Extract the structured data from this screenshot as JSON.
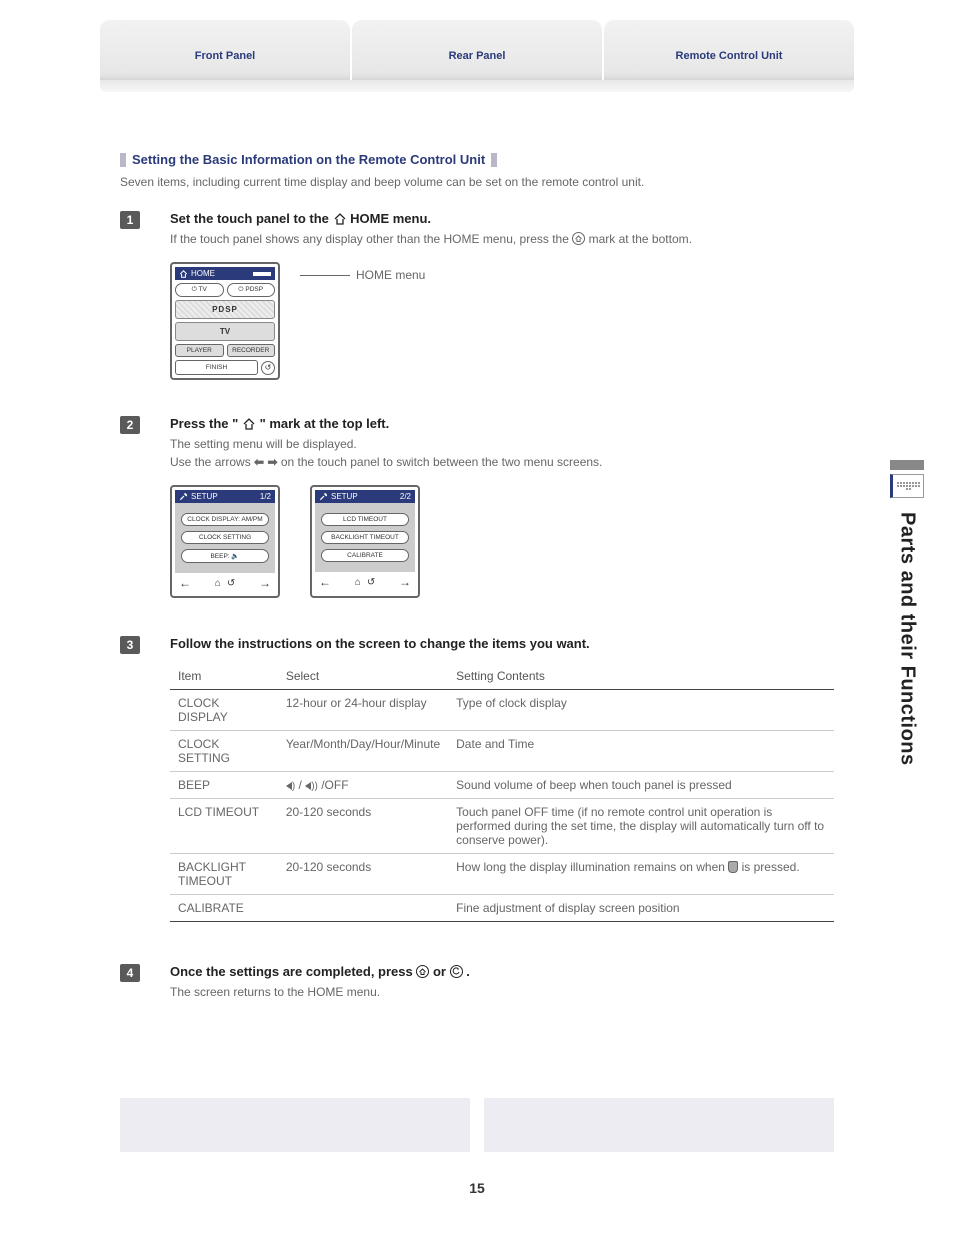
{
  "tabs": {
    "front": "Front Panel",
    "rear": "Rear Panel",
    "remote": "Remote Control Unit"
  },
  "section": {
    "title": "Setting the Basic Information on the Remote Control Unit",
    "intro": "Seven items, including current time display and beep volume can be set on the remote control unit."
  },
  "steps": {
    "s1": {
      "num": "1",
      "title_a": "Set the touch panel to the ",
      "title_b": " HOME menu.",
      "text_a": "If the touch panel shows any display other than the HOME menu, press the ",
      "text_b": " mark at the bottom.",
      "leader": "HOME menu"
    },
    "s2": {
      "num": "2",
      "title_a": "Press the \"",
      "title_b": "\" mark at the top left.",
      "text1": "The setting menu will be displayed.",
      "text2_a": "Use the arrows ",
      "text2_b": " on the touch panel to switch between the two menu screens."
    },
    "s3": {
      "num": "3",
      "title": "Follow the instructions on the screen to change the items you want."
    },
    "s4": {
      "num": "4",
      "title_a": "Once the settings are completed, press ",
      "title_b": " or ",
      "title_c": ".",
      "text": "The screen returns to the HOME menu."
    }
  },
  "home_screen": {
    "header": "HOME",
    "btn_tv_power": "⏻ TV",
    "btn_pdsp_power": "⏻ PDSP",
    "wide": "PDSP",
    "tv": "TV",
    "player": "PLAYER",
    "recorder": "RECORDER",
    "finish": "FINISH"
  },
  "setup_screens": {
    "s1": {
      "title": "SETUP",
      "page": "1/2",
      "items": [
        "CLOCK DISPLAY: AM/PM",
        "CLOCK SETTING",
        "BEEP: 🔈"
      ]
    },
    "s2": {
      "title": "SETUP",
      "page": "2/2",
      "items": [
        "LCD TIMEOUT",
        "BACKLIGHT TIMEOUT",
        "CALIBRATE"
      ]
    }
  },
  "table": {
    "headers": {
      "item": "Item",
      "select": "Select",
      "contents": "Setting Contents"
    },
    "rows": [
      {
        "item": "CLOCK DISPLAY",
        "select": "12-hour or 24-hour display",
        "contents": "Type of clock display"
      },
      {
        "item": "CLOCK SETTING",
        "select": "Year/Month/Day/Hour/Minute",
        "contents": "Date and Time"
      },
      {
        "item": "BEEP",
        "select_is_icons": true,
        "select_suffix": " /OFF",
        "contents": "Sound volume of beep when touch panel is pressed"
      },
      {
        "item": "LCD TIMEOUT",
        "select": "20-120 seconds",
        "contents": "Touch panel OFF time (if no remote control unit operation is performed during the set time, the display will automatically turn off to conserve power)."
      },
      {
        "item": "BACKLIGHT TIMEOUT",
        "select": "20-120 seconds",
        "contents_a": "How long the display illumination remains on when ",
        "contents_b": " is pressed.",
        "has_light_icon": true
      },
      {
        "item": "CALIBRATE",
        "select": "",
        "contents": "Fine adjustment of display screen position"
      }
    ]
  },
  "sidebar": {
    "text": "Parts and their Functions"
  },
  "page_number": "15",
  "icons": {
    "home_glyph": "⌂",
    "home_circle": "⌂",
    "return": "↺",
    "arrow_left": "←",
    "arrow_right": "→",
    "arrow_left_bold": "⬅",
    "arrow_right_bold": "➡"
  }
}
